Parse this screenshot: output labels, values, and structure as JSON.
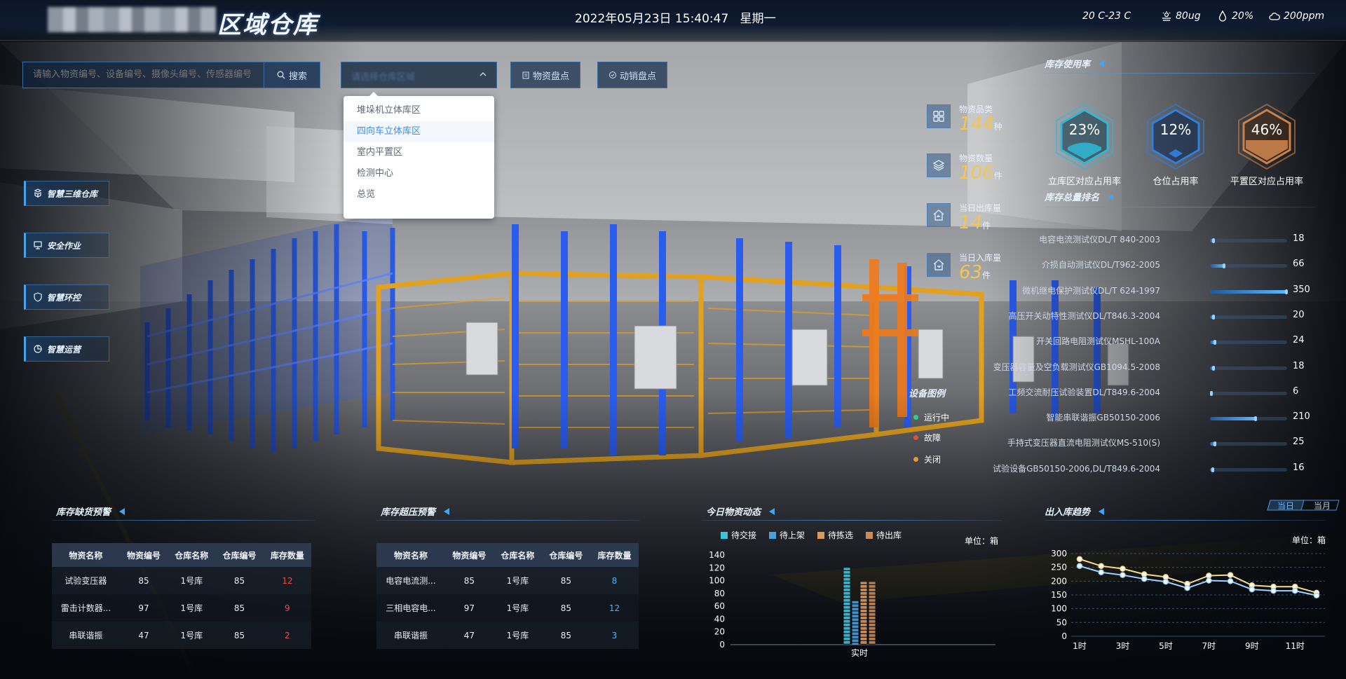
{
  "header": {
    "title": "区域仓库",
    "datetime": "2022年05月23日 15:40:47",
    "weekday": "星期一",
    "temperature": "20 C-23 C",
    "pm": "80ug",
    "humidity": "20%",
    "co2": "200ppm"
  },
  "toolbar": {
    "search_placeholder": "请输入物资编号、设备编号、摄像头编号、传感器编号",
    "search_label": "搜索",
    "inventory_label": "物资盘点",
    "dynamic_label": "动销盘点"
  },
  "dropdown": {
    "options": [
      "堆垛机立体库区",
      "四向车立体库区",
      "室内平置区",
      "检测中心",
      "总览"
    ],
    "selected_index": 1
  },
  "leftnav": [
    "智慧三维仓库",
    "安全作业",
    "智慧环控",
    "智慧运营"
  ],
  "stats": [
    {
      "label": "物资品类",
      "value": "144",
      "unit": "种"
    },
    {
      "label": "物资数量",
      "value": "106",
      "unit": "件"
    },
    {
      "label": "当日出库量",
      "value": "14",
      "unit": "件"
    },
    {
      "label": "当日入库量",
      "value": "63",
      "unit": "件"
    }
  ],
  "usage": {
    "title": "库存使用率",
    "items": [
      {
        "pct": "23%",
        "label": "立库区对应占用率",
        "color": "#2fb8d6"
      },
      {
        "pct": "12%",
        "label": "仓位占用率",
        "color": "#2f7fe0"
      },
      {
        "pct": "46%",
        "label": "平置区对应占用率",
        "color": "#c9824a"
      }
    ]
  },
  "ranking": {
    "title": "库存总量排名",
    "max": 350,
    "items": [
      {
        "name": "电容电流测试仪DL/T 840-2003",
        "value": 18
      },
      {
        "name": "介损自动测试仪DL/T962-2005",
        "value": 66
      },
      {
        "name": "微机继电保护测试仪DL/T 624-1997",
        "value": 350
      },
      {
        "name": "高压开关动特性测试仪DL/T846.3-2004",
        "value": 20
      },
      {
        "name": "开关回路电阻测试仪MSHL-100A",
        "value": 24
      },
      {
        "name": "变压器容量及空负载测试仪GB1094.5-2008",
        "value": 18
      },
      {
        "name": "工频交流耐压试验装置DL/T849.6-2004",
        "value": 6
      },
      {
        "name": "智能串联谐振GB50150-2006",
        "value": 210
      },
      {
        "name": "手持式变压器直流电阻测试仪MS-510(S)",
        "value": 25
      },
      {
        "name": "试验设备GB50150-2006,DL/T849.6-2004",
        "value": 16
      }
    ]
  },
  "device_legend": {
    "title": "设备图例",
    "items": [
      {
        "label": "运行中",
        "color": "#2ecf8a"
      },
      {
        "label": "故障",
        "color": "#e54a3c"
      },
      {
        "label": "关闭",
        "color": "#e39a3a"
      }
    ]
  },
  "shortage": {
    "title": "库存缺货预警",
    "columns": [
      "物资名称",
      "物资编号",
      "仓库名称",
      "仓库编号",
      "库存数量"
    ],
    "rows": [
      [
        "试验变压器",
        "85",
        "1号库",
        "85",
        "12"
      ],
      [
        "雷击计数器...",
        "97",
        "1号库",
        "85",
        "9"
      ],
      [
        "串联谐振",
        "47",
        "1号库",
        "85",
        "2"
      ]
    ],
    "qty_color": "#f04b4b"
  },
  "overstock": {
    "title": "库存超压预警",
    "columns": [
      "物资名称",
      "物资编号",
      "仓库名称",
      "仓库编号",
      "库存数量"
    ],
    "rows": [
      [
        "电容电流测...",
        "85",
        "1号库",
        "85",
        "8"
      ],
      [
        "三相电容电...",
        "97",
        "1号库",
        "85",
        "12"
      ],
      [
        "串联谐振",
        "47",
        "1号库",
        "85",
        "3"
      ]
    ],
    "qty_color": "#4fb4f5"
  },
  "daily": {
    "title": "今日物资动态",
    "unit": "单位：箱",
    "legend": [
      {
        "name": "待交接",
        "color": "#3fc3d8"
      },
      {
        "name": "待上架",
        "color": "#4aa0d8"
      },
      {
        "name": "待拣选",
        "color": "#d99a5a"
      },
      {
        "name": "待出库",
        "color": "#c98a55"
      }
    ]
  },
  "trend": {
    "title": "出入库趋势",
    "unit": "单位：箱",
    "tabs": [
      "当日",
      "当月"
    ]
  },
  "chart_data": [
    {
      "type": "bar",
      "categories": [
        "实时"
      ],
      "series": [
        {
          "name": "待交接",
          "values": [
            120
          ]
        },
        {
          "name": "待上架",
          "values": [
            68
          ]
        },
        {
          "name": "待拣选",
          "values": [
            98
          ]
        },
        {
          "name": "待出库",
          "values": [
            98
          ]
        }
      ],
      "ylim": [
        0,
        140
      ],
      "yticks": [
        0,
        20,
        40,
        60,
        80,
        100,
        120,
        140
      ]
    },
    {
      "type": "line",
      "x": [
        "1时",
        "2时",
        "3时",
        "4时",
        "5时",
        "6时",
        "7时",
        "8时",
        "9时",
        "10时",
        "11时",
        "12时"
      ],
      "xticks": [
        "1时",
        "3时",
        "5时",
        "7时",
        "9时",
        "11时"
      ],
      "series": [
        {
          "values": [
            280,
            255,
            245,
            225,
            215,
            190,
            220,
            222,
            185,
            180,
            180,
            158
          ],
          "color": "#f6d98a"
        },
        {
          "values": [
            255,
            232,
            222,
            208,
            198,
            175,
            202,
            200,
            170,
            165,
            165,
            148
          ],
          "color": "#9fd2ff"
        }
      ],
      "ylim": [
        0,
        300
      ],
      "yticks": [
        0,
        50,
        100,
        150,
        200,
        250,
        300
      ]
    }
  ]
}
